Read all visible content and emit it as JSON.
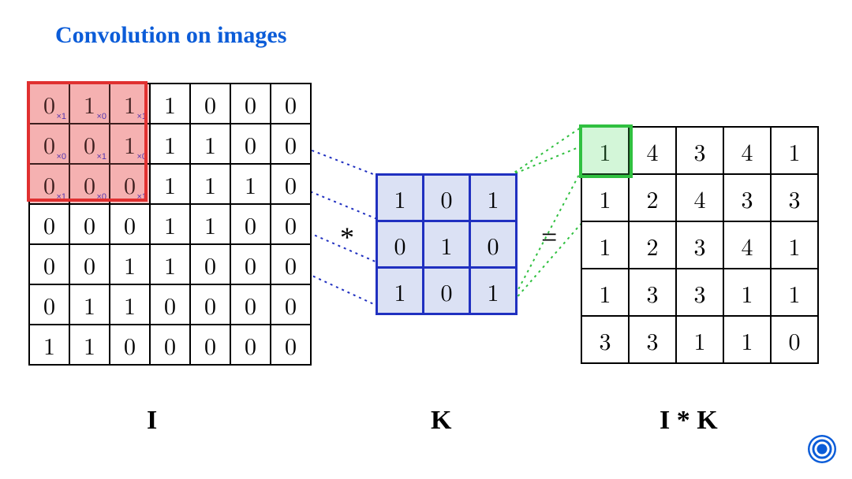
{
  "title": "Convolution on images",
  "operator_conv": "*",
  "operator_eq": "=",
  "labels": {
    "I": "I",
    "K": "K",
    "IK": "I * K"
  },
  "colors": {
    "title": "#0b5cd8",
    "red": "#e03030",
    "blue": "#2030c0",
    "green": "#30c040",
    "kernel_fill": "#dbe1f4",
    "highlight_fill": "#f7c5c5"
  },
  "chart_data": {
    "type": "table",
    "I": {
      "rows": 7,
      "cols": 7,
      "values": [
        [
          0,
          1,
          1,
          1,
          0,
          0,
          0
        ],
        [
          0,
          0,
          1,
          1,
          1,
          0,
          0
        ],
        [
          0,
          0,
          0,
          1,
          1,
          1,
          0
        ],
        [
          0,
          0,
          0,
          1,
          1,
          0,
          0
        ],
        [
          0,
          0,
          1,
          1,
          0,
          0,
          0
        ],
        [
          0,
          1,
          1,
          0,
          0,
          0,
          0
        ],
        [
          1,
          1,
          0,
          0,
          0,
          0,
          0
        ]
      ],
      "window": {
        "row": 0,
        "col": 0,
        "size": 3
      },
      "weights": [
        [
          1,
          0,
          1
        ],
        [
          0,
          1,
          0
        ],
        [
          1,
          0,
          1
        ]
      ]
    },
    "K": {
      "rows": 3,
      "cols": 3,
      "values": [
        [
          1,
          0,
          1
        ],
        [
          0,
          1,
          0
        ],
        [
          1,
          0,
          1
        ]
      ]
    },
    "O": {
      "rows": 5,
      "cols": 5,
      "values": [
        [
          1,
          4,
          3,
          4,
          1
        ],
        [
          1,
          2,
          4,
          3,
          3
        ],
        [
          1,
          2,
          3,
          4,
          1
        ],
        [
          1,
          3,
          3,
          1,
          1
        ],
        [
          3,
          3,
          1,
          1,
          0
        ]
      ],
      "highlight": {
        "row": 0,
        "col": 0
      }
    }
  }
}
